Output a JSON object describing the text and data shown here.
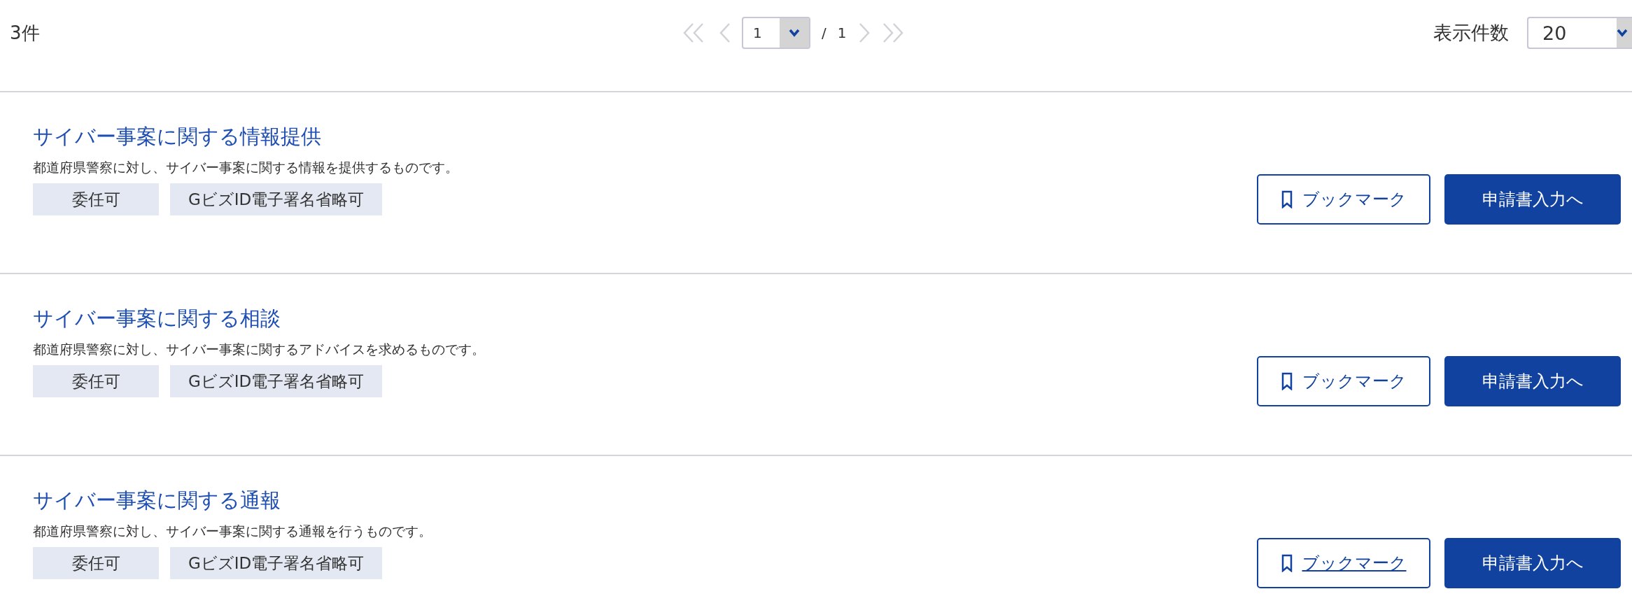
{
  "result_count": "3件",
  "pagination": {
    "page": "1",
    "separator": "/",
    "total": "1",
    "disabled_first": true,
    "disabled_last": true
  },
  "per_page": {
    "label": "表示件数",
    "value": "20"
  },
  "results": [
    {
      "title": "サイバー事案に関する情報提供",
      "description": "都道府県警察に対し、サイバー事案に関する情報を提供するものです。",
      "tags": [
        "委任可",
        "GビズID電子署名省略可"
      ],
      "bookmark": {
        "label": "ブックマーク",
        "hovered": false
      },
      "apply": "申請書入力へ"
    },
    {
      "title": "サイバー事案に関する相談",
      "description": "都道府県警察に対し、サイバー事案に関するアドバイスを求めるものです。",
      "tags": [
        "委任可",
        "GビズID電子署名省略可"
      ],
      "bookmark": {
        "label": "ブックマーク",
        "hovered": false
      },
      "apply": "申請書入力へ"
    },
    {
      "title": "サイバー事案に関する通報",
      "description": "都道府県警察に対し、サイバー事案に関する通報を行うものです。",
      "tags": [
        "委任可",
        "GビズID電子署名省略可"
      ],
      "bookmark": {
        "label": "ブックマーク",
        "hovered": true
      },
      "apply": "申請書入力へ"
    }
  ]
}
